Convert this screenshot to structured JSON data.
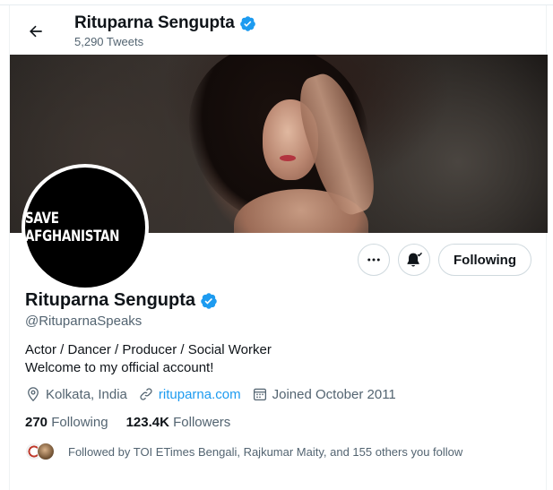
{
  "header": {
    "name": "Rituparna Sengupta",
    "tweet_count": "5,290 Tweets",
    "back_icon": "arrow-left-icon",
    "verified_icon": "verified-badge-icon"
  },
  "banner": {
    "description": ""
  },
  "avatar": {
    "text": "SAVE AFGHANISTAN"
  },
  "actions": {
    "more_icon": "more-horizontal-icon",
    "notify_icon": "bell-check-icon",
    "following_label": "Following"
  },
  "profile": {
    "name": "Rituparna Sengupta",
    "handle": "@RituparnaSpeaks",
    "bio_line1": "Actor / Dancer / Producer / Social Worker",
    "bio_line2": "Welcome to my official account!",
    "location": "Kolkata, India",
    "website": "rituparna.com",
    "joined": "Joined October 2011"
  },
  "stats": {
    "following_count": "270",
    "following_label": "Following",
    "followers_count": "123.4K",
    "followers_label": "Followers"
  },
  "followed_by": {
    "text": "Followed by TOI ETimes Bengali, Rajkumar Maity, and 155 others you follow"
  },
  "colors": {
    "accent": "#1d9bf0",
    "text": "#0f1419",
    "secondary": "#536471",
    "border": "#cfd9de"
  }
}
